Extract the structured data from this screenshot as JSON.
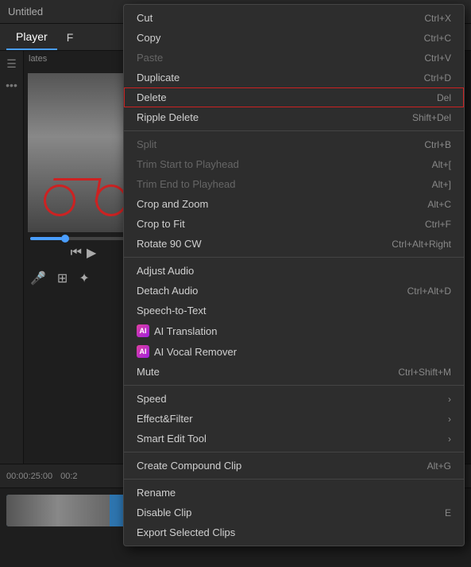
{
  "app": {
    "title": "Untitled"
  },
  "tabs": [
    {
      "label": "Player",
      "active": true
    },
    {
      "label": "F",
      "active": false
    }
  ],
  "panels": {
    "label": "lates"
  },
  "timeline": {
    "timestamp": "00:00:25:00",
    "timestamp2": "00:2"
  },
  "context_menu": {
    "items": [
      {
        "id": "cut",
        "label": "Cut",
        "shortcut": "Ctrl+X",
        "disabled": false,
        "separator_after": false
      },
      {
        "id": "copy",
        "label": "Copy",
        "shortcut": "Ctrl+C",
        "disabled": false,
        "separator_after": false
      },
      {
        "id": "paste",
        "label": "Paste",
        "shortcut": "Ctrl+V",
        "disabled": true,
        "separator_after": false
      },
      {
        "id": "duplicate",
        "label": "Duplicate",
        "shortcut": "Ctrl+D",
        "disabled": false,
        "separator_after": false
      },
      {
        "id": "delete",
        "label": "Delete",
        "shortcut": "Del",
        "disabled": false,
        "highlighted": true,
        "separator_after": false
      },
      {
        "id": "ripple-delete",
        "label": "Ripple Delete",
        "shortcut": "Shift+Del",
        "disabled": false,
        "separator_after": true
      },
      {
        "id": "split",
        "label": "Split",
        "shortcut": "Ctrl+B",
        "disabled": true,
        "separator_after": false
      },
      {
        "id": "trim-start",
        "label": "Trim Start to Playhead",
        "shortcut": "Alt+[",
        "disabled": true,
        "separator_after": false
      },
      {
        "id": "trim-end",
        "label": "Trim End to Playhead",
        "shortcut": "Alt+]",
        "disabled": true,
        "separator_after": false
      },
      {
        "id": "crop-zoom",
        "label": "Crop and Zoom",
        "shortcut": "Alt+C",
        "disabled": false,
        "separator_after": false
      },
      {
        "id": "crop-fit",
        "label": "Crop to Fit",
        "shortcut": "Ctrl+F",
        "disabled": false,
        "separator_after": false
      },
      {
        "id": "rotate",
        "label": "Rotate 90 CW",
        "shortcut": "Ctrl+Alt+Right",
        "disabled": false,
        "separator_after": true
      },
      {
        "id": "adjust-audio",
        "label": "Adjust Audio",
        "shortcut": "",
        "disabled": false,
        "separator_after": false
      },
      {
        "id": "detach-audio",
        "label": "Detach Audio",
        "shortcut": "Ctrl+Alt+D",
        "disabled": false,
        "separator_after": false
      },
      {
        "id": "speech-to-text",
        "label": "Speech-to-Text",
        "shortcut": "",
        "disabled": false,
        "separator_after": false
      },
      {
        "id": "ai-translation",
        "label": "AI Translation",
        "shortcut": "",
        "disabled": false,
        "has_ai": true,
        "ai_color": "pink",
        "separator_after": false
      },
      {
        "id": "ai-vocal",
        "label": "AI Vocal Remover",
        "shortcut": "",
        "disabled": false,
        "has_ai": true,
        "ai_color": "pink",
        "separator_after": false
      },
      {
        "id": "mute",
        "label": "Mute",
        "shortcut": "Ctrl+Shift+M",
        "disabled": false,
        "separator_after": true
      },
      {
        "id": "speed",
        "label": "Speed",
        "shortcut": "",
        "has_arrow": true,
        "disabled": false,
        "separator_after": false
      },
      {
        "id": "effect-filter",
        "label": "Effect&Filter",
        "shortcut": "",
        "has_arrow": true,
        "disabled": false,
        "separator_after": false
      },
      {
        "id": "smart-edit",
        "label": "Smart Edit Tool",
        "shortcut": "",
        "has_arrow": true,
        "disabled": false,
        "separator_after": true
      },
      {
        "id": "compound",
        "label": "Create Compound Clip",
        "shortcut": "Alt+G",
        "disabled": false,
        "separator_after": true
      },
      {
        "id": "rename",
        "label": "Rename",
        "shortcut": "",
        "disabled": false,
        "separator_after": false
      },
      {
        "id": "disable-clip",
        "label": "Disable Clip",
        "shortcut": "E",
        "disabled": false,
        "separator_after": false
      },
      {
        "id": "export",
        "label": "Export Selected Clips",
        "shortcut": "",
        "disabled": false,
        "separator_after": false
      }
    ]
  }
}
